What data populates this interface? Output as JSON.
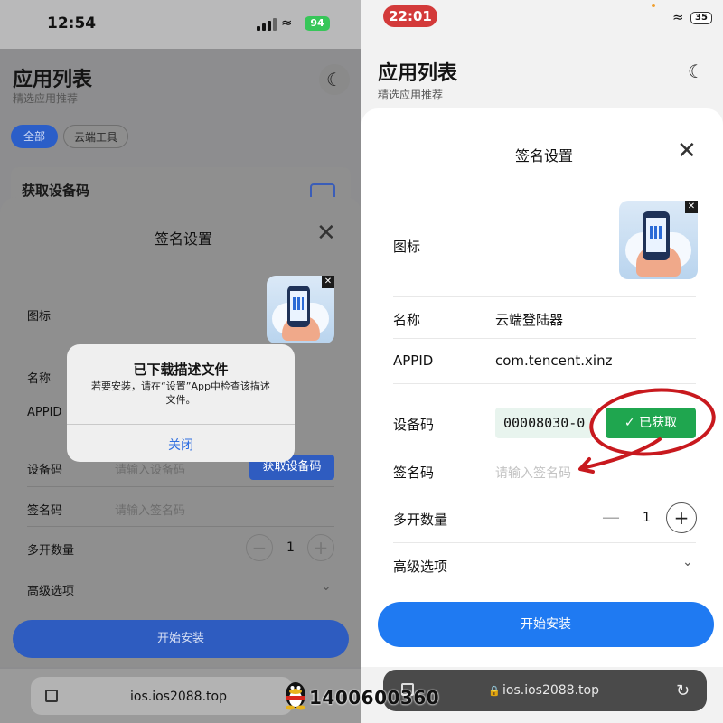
{
  "left": {
    "status": {
      "time": "12:54",
      "battery": "94"
    },
    "header": {
      "title": "应用列表",
      "subtitle": "精选应用推荐"
    },
    "filters": {
      "all": "全部",
      "cloud_tools": "云端工具"
    },
    "background_card": {
      "title": "获取设备码"
    },
    "sheet": {
      "title": "签名设置",
      "icon_label": "图标",
      "name_label": "名称",
      "appid_label": "APPID",
      "device_label": "设备码",
      "device_placeholder": "请输入设备码",
      "get_code_button": "获取设备码",
      "sign_label": "签名码",
      "sign_placeholder": "请输入签名码",
      "multi_label": "多开数量",
      "multi_value": "1",
      "advanced_label": "高级选项",
      "install_button": "开始安装"
    },
    "dialog": {
      "title": "已下载描述文件",
      "message": "若要安装，请在“设置”App中检查该描述文件。",
      "close": "关闭"
    },
    "url": "ios.ios2088.top",
    "watermark": "1400600360"
  },
  "right": {
    "status": {
      "time": "22:01",
      "battery": "35"
    },
    "header": {
      "title": "应用列表",
      "subtitle": "精选应用推荐"
    },
    "sheet": {
      "title": "签名设置",
      "icon_label": "图标",
      "name_label": "名称",
      "name_value": "云端登陆器",
      "appid_label": "APPID",
      "appid_value": "com.tencent.xinz",
      "device_label": "设备码",
      "device_value": "00008030-0",
      "obtained_button": "✓ 已获取",
      "sign_label": "签名码",
      "sign_placeholder": "请输入签名码",
      "multi_label": "多开数量",
      "multi_value": "1",
      "advanced_label": "高级选项",
      "install_button": "开始安装"
    },
    "url": "ios.ios2088.top"
  },
  "colors": {
    "primary_blue": "#1f7af2",
    "success_green": "#1fa64f",
    "annotation_red": "#c8191e"
  }
}
